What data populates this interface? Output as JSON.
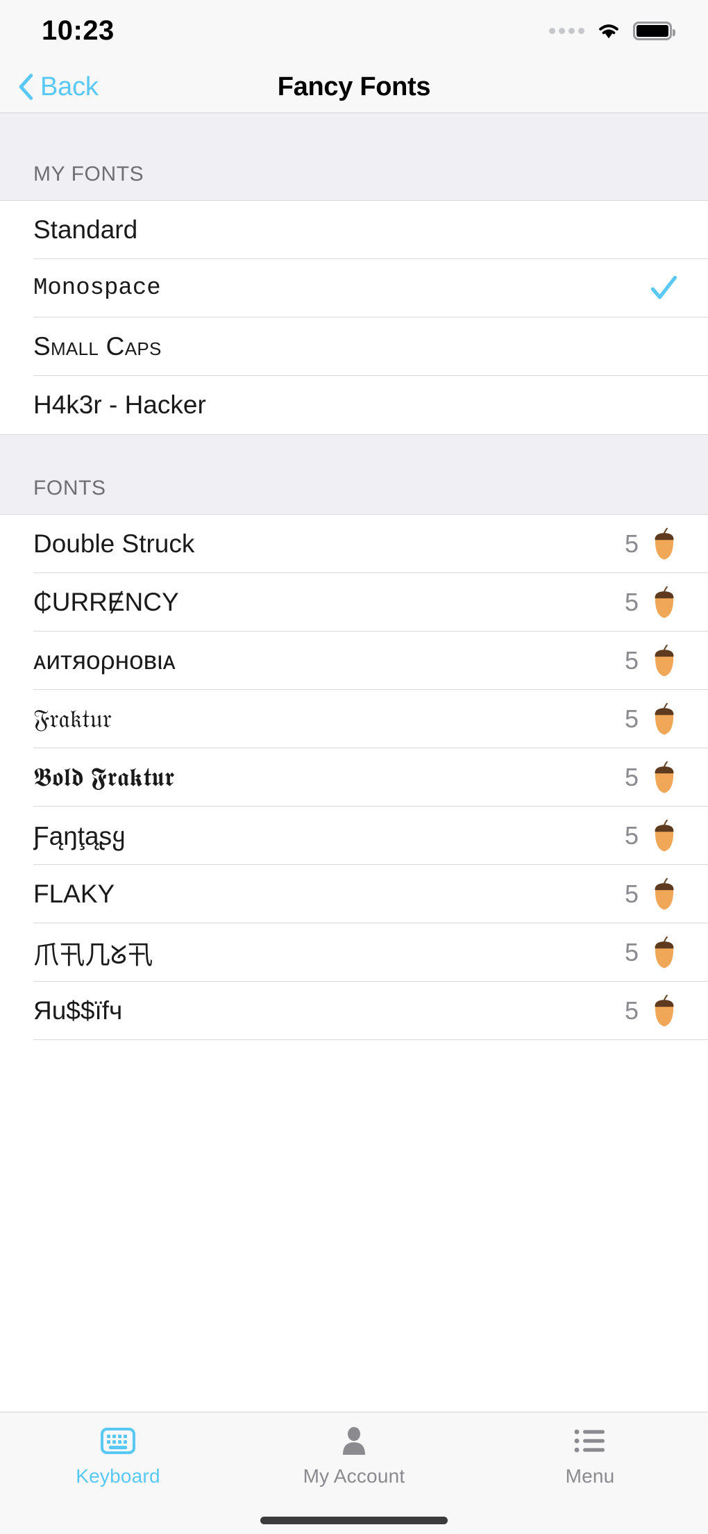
{
  "status_bar": {
    "time": "10:23",
    "signal_icon": "signal-dots-icon",
    "wifi_icon": "wifi-icon",
    "battery_icon": "battery-icon"
  },
  "nav_bar": {
    "back_label": "Back",
    "back_icon": "chevron-left-icon",
    "title": "Fancy Fonts"
  },
  "sections": [
    {
      "header": "MY FONTS",
      "rows": [
        {
          "label": "Standard",
          "style": "plain",
          "selected": false
        },
        {
          "label": "Monospace",
          "style": "mono",
          "selected": true
        },
        {
          "label": "Small Caps",
          "style": "smallcaps",
          "selected": false
        },
        {
          "label": "H4k3r - Hacker",
          "style": "plain",
          "selected": false
        }
      ]
    },
    {
      "header": "FONTS",
      "rows": [
        {
          "label": "Double Struck",
          "cost": "5",
          "icon": "acorn-icon"
        },
        {
          "label": "₵URRɆNCY",
          "cost": "5",
          "icon": "acorn-icon"
        },
        {
          "label": "ᴀиᴛяᴏρнᴏвιᴀ",
          "cost": "5",
          "icon": "acorn-icon"
        },
        {
          "label": "𝔉𝔯𝔞𝔨𝔱𝔲𝔯",
          "cost": "5",
          "icon": "acorn-icon"
        },
        {
          "label": "𝕭𝖔𝖑𝖉 𝕱𝖗𝖆𝖐𝖙𝖚𝖗",
          "cost": "5",
          "icon": "acorn-icon"
        },
        {
          "label": "Ƒąŋţąʂყ",
          "cost": "5",
          "icon": "acorn-icon"
        },
        {
          "label": "FLAKY",
          "cost": "5",
          "icon": "acorn-icon"
        },
        {
          "label": "爪卂几ᘜ卂",
          "cost": "5",
          "icon": "acorn-icon"
        },
        {
          "label": "Яu$$ïfч",
          "cost": "5",
          "icon": "acorn-icon"
        }
      ]
    }
  ],
  "tab_bar": {
    "items": [
      {
        "label": "Keyboard",
        "icon": "keyboard-icon",
        "active": true
      },
      {
        "label": "My Account",
        "icon": "person-icon",
        "active": false
      },
      {
        "label": "Menu",
        "icon": "list-icon",
        "active": false
      }
    ]
  },
  "colors": {
    "accent": "#5ac8f5",
    "checkmark": "#5ac8f5",
    "inactive_tab": "#8a8a8f",
    "section_header_bg": "#f0f0f4",
    "cost_text": "#8a8a8f"
  }
}
